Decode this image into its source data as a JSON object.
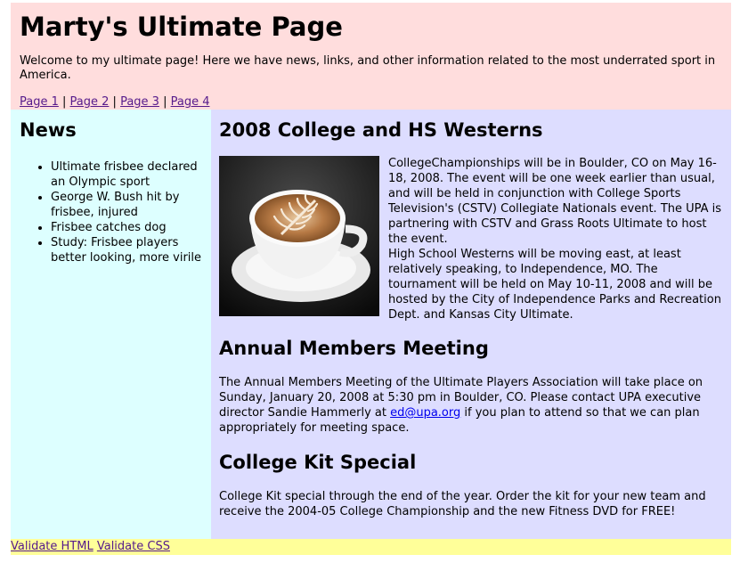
{
  "header": {
    "title": "Marty's Ultimate Page",
    "welcome": "Welcome to my ultimate page! Here we have news, links, and other information related to the most underrated sport in America.",
    "pages": [
      "Page 1",
      "Page 2",
      "Page 3",
      "Page 4"
    ],
    "separator": " | "
  },
  "sidebar": {
    "heading": "News",
    "items": [
      "Ultimate frisbee declared an Olympic sport",
      "George W. Bush hit by frisbee, injured",
      "Frisbee catches dog",
      "Study: Frisbee players better looking, more virile"
    ]
  },
  "main": {
    "section1": {
      "heading": "2008 College and HS Westerns",
      "image": "coffee-latte-art-photo",
      "p1": "CollegeChampionships will be in Boulder, CO on May 16-18, 2008. The event will be one week earlier than usual, and will be held in conjunction with College Sports Television's (CSTV) Collegiate Nationals event. The UPA is partnering with CSTV and Grass Roots Ultimate to host the event.",
      "p2": "High School Westerns will be moving east, at least relatively speaking, to Independence, MO. The tournament will be held on May 10-11, 2008 and will be hosted by the City of Independence Parks and Recreation Dept. and Kansas City Ultimate."
    },
    "section2": {
      "heading": "Annual Members Meeting",
      "text_before": "The Annual Members Meeting of the Ultimate Players Association will take place on Sunday, January 20, 2008 at 5:30 pm in Boulder, CO. Please contact UPA executive director Sandie Hammerly at ",
      "email": "ed@upa.org",
      "text_after": " if you plan to attend so that we can plan appropriately for meeting space."
    },
    "section3": {
      "heading": "College Kit Special",
      "text": "College Kit special through the end of the year. Order the kit for your new team and receive the 2004-05 College Championship and the new Fitness DVD for FREE!"
    }
  },
  "footer": {
    "validate_html": "Validate HTML",
    "validate_css": "Validate CSS"
  },
  "colors": {
    "header_bg": "#ffdddd",
    "sidebar_bg": "#ddffff",
    "main_bg": "#ddddff",
    "footer_bg": "#ffff99",
    "visited_link": "#551a8b",
    "link": "#0000ee"
  }
}
